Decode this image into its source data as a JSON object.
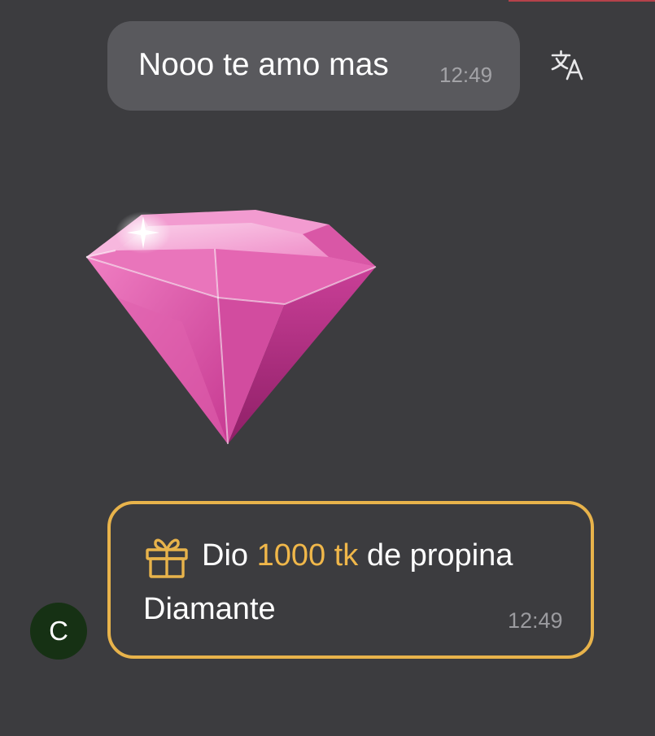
{
  "message": {
    "text": "Nooo te amo mas",
    "time": "12:49"
  },
  "translate_icon": "translate-icon",
  "sticker": {
    "icon": "pink-diamond-sticker",
    "color": "#e84fa8"
  },
  "gift": {
    "icon": "gift-icon",
    "prefix": "Dio",
    "amount": "1000 tk",
    "suffix": "de propina",
    "name": "Diamante",
    "time": "12:49",
    "accent_color": "#e8b34b"
  },
  "avatar": {
    "initial": "C",
    "color": "#163114"
  }
}
